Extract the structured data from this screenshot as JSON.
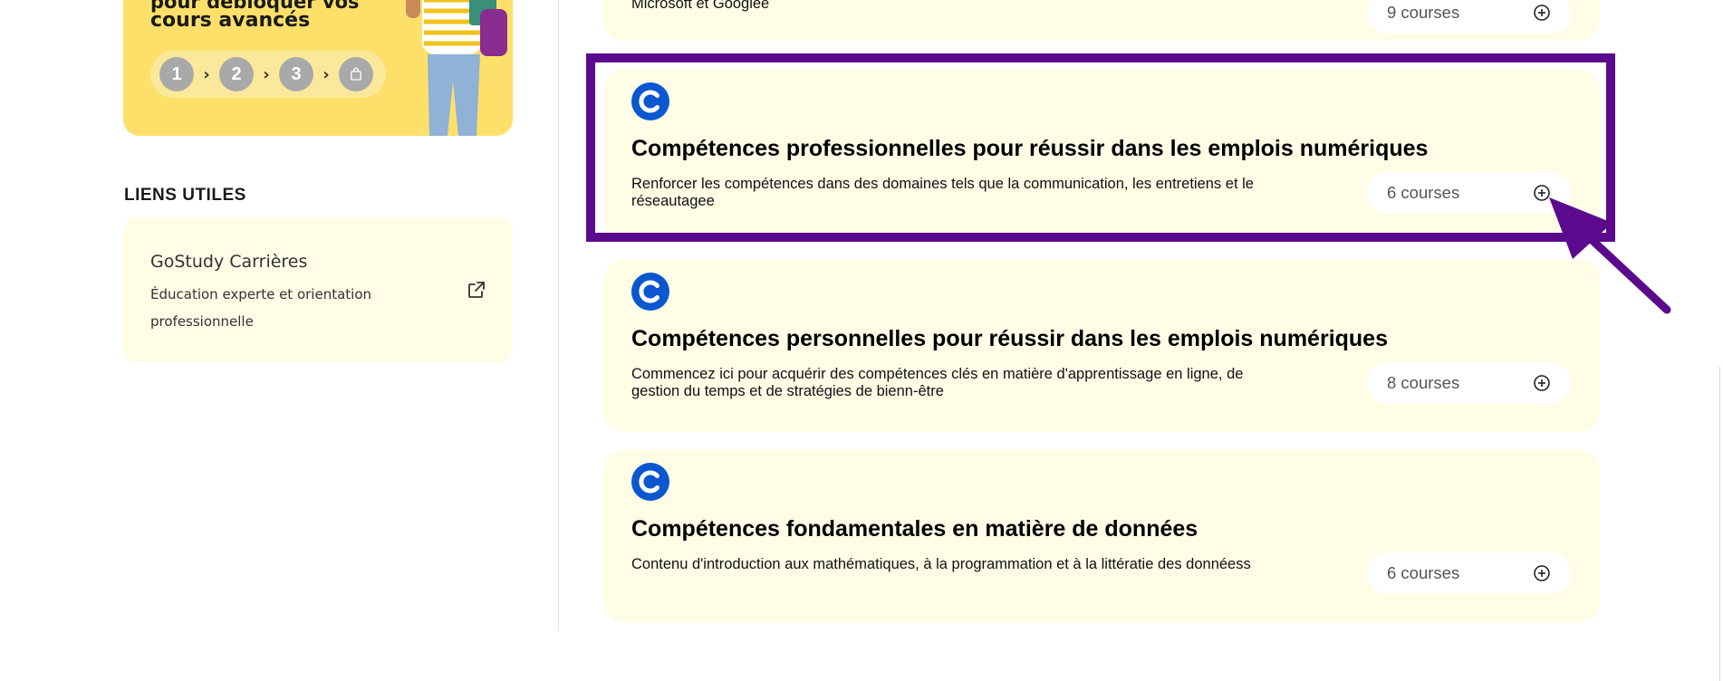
{
  "promo": {
    "line1": "pour débloquer vos",
    "line2": "cours avancés",
    "steps": [
      "1",
      "2",
      "3"
    ],
    "step_chevron": "›"
  },
  "links": {
    "title": "LIENS UTILES",
    "item": {
      "title": "GoStudy Carrières",
      "description": "Éducation experte et orientation professionnelle",
      "icon": "external-link-icon"
    }
  },
  "courses": [
    {
      "description": "Microsoft et Googlee",
      "count": "9 courses"
    },
    {
      "title": "Compétences professionnelles pour réussir dans les emplois numériques",
      "description": "Renforcer les compétences dans des domaines tels que la communication, les entretiens et le réseautagee",
      "count": "6 courses"
    },
    {
      "title": "Compétences personnelles pour réussir dans les emplois numériques",
      "description": "Commencez ici pour acquérir des compétences clés en matière d'apprentissage en ligne, de gestion du temps et de stratégies de bienn-être",
      "count": "8 courses"
    },
    {
      "title": "Compétences fondamentales en matière de données",
      "description": "Contenu d'introduction aux mathématiques, à la programmation et à la littératie des donnéess",
      "count": "6 courses"
    }
  ],
  "colors": {
    "card_background": "#fffde6",
    "promo_background": "#fde06a",
    "logo_blue": "#0b57d0",
    "highlight_purple": "#5b0a8e"
  },
  "icons": {
    "provider_logo": "coursera-logo-icon",
    "expand": "plus-circle-icon",
    "locked_step": "shopping-bag-icon"
  }
}
